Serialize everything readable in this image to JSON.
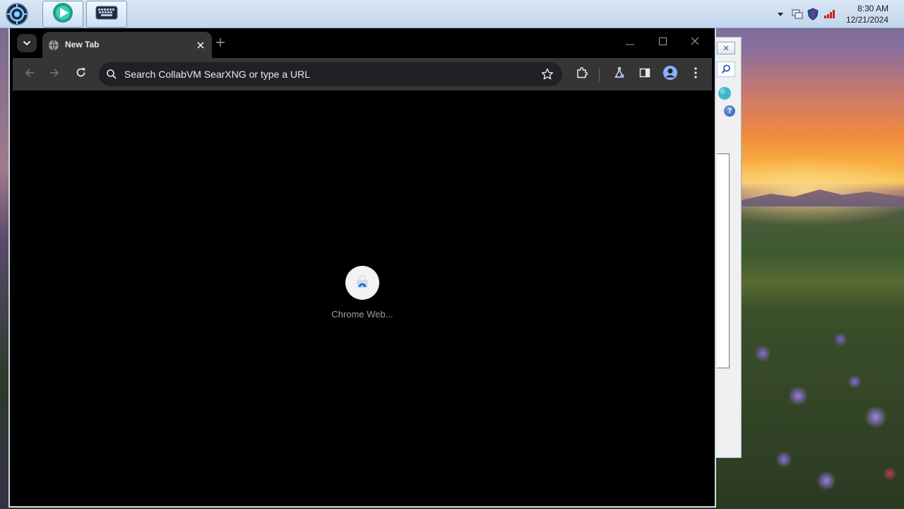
{
  "taskbar": {
    "start_icon": "start-orb-icon",
    "pinned": [
      {
        "name": "media-player-icon"
      },
      {
        "name": "keyboard-icon"
      }
    ],
    "tray_icons": [
      "show-hidden-icons-chevron",
      "network-icon",
      "security-shield-icon",
      "signal-bars-icon"
    ],
    "clock": {
      "time": "8:30 AM",
      "date": "12/21/2024"
    }
  },
  "browser": {
    "tab": {
      "title": "New Tab",
      "favicon": "globe-icon"
    },
    "omnibox": {
      "placeholder": "Search CollabVM SearXNG or type a URL"
    },
    "shortcuts": [
      {
        "label": "Chrome Web...",
        "icon": "chrome-web-store-icon"
      }
    ],
    "colors": {
      "frame": "#000000",
      "toolbar": "#353535",
      "omnibox": "#202124",
      "text": "#e8eaed"
    }
  },
  "background_window": {
    "help_label": "?"
  }
}
